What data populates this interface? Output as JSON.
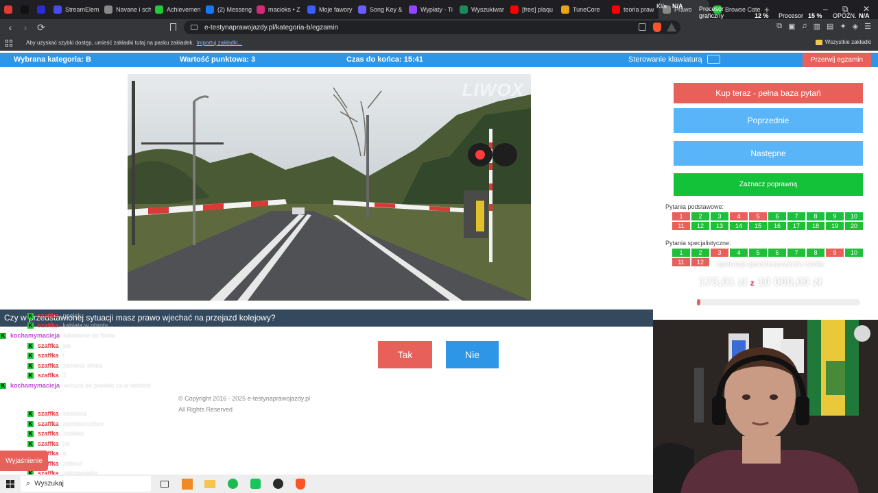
{
  "browser": {
    "tabs": [
      {
        "label": "",
        "color": "#e53935"
      },
      {
        "label": "",
        "color": "#111111"
      },
      {
        "label": "",
        "color": "#2b2bd6"
      },
      {
        "label": "StreamElem",
        "color": "#4a4af0"
      },
      {
        "label": "Navane i sch",
        "color": "#888888"
      },
      {
        "label": "Achievemen",
        "color": "#22c73a"
      },
      {
        "label": "(2) Messeng",
        "color": "#1877f2"
      },
      {
        "label": "macioks • Z",
        "color": "#d62976"
      },
      {
        "label": "Moje fawory",
        "color": "#3b5cff"
      },
      {
        "label": "Song Key &",
        "color": "#6b5cff"
      },
      {
        "label": "Wypłaty - Ti",
        "color": "#9146ff"
      },
      {
        "label": "Wyszukiwar",
        "color": "#1a8a5a"
      },
      {
        "label": "[free] plaqu",
        "color": "#ff0000"
      },
      {
        "label": "TuneCore",
        "color": "#e8a317"
      },
      {
        "label": "teoria praw",
        "color": "#ff0000"
      },
      {
        "label": "Prawo",
        "color": "#888888"
      },
      {
        "label": "Browse Cate",
        "color": "#22c73a"
      }
    ],
    "new_tab": "+",
    "stats": {
      "net_label": "Kl/s",
      "net_value": "N/A",
      "gpu_label": "Procesor graficzny",
      "gpu_value": "12 %",
      "cpu_label": "Procesor",
      "cpu_value": "15 %",
      "lag_label": "OPÓŹN.",
      "lag_value": "N/A"
    },
    "window_controls": {
      "minimize": "–",
      "restore": "⧉",
      "close": "✕"
    },
    "nav": {
      "back": "‹",
      "forward": "›",
      "reload": "⟳"
    },
    "url": "e-testynaprawojazdy.pl/kategoria-b/egzamin",
    "bookmarks_hint": "Aby uzyskać szybki dostęp, umieść zakładki tutaj na pasku zakładek.",
    "bookmarks_import": "Importuj zakładki...",
    "bookmarks_all": "Wszystkie zakładki"
  },
  "exam": {
    "category": "Wybrana kategoria: B",
    "points": "Wartość punktowa: 3",
    "time": "Czas do końca: 15:41",
    "keyboard": "Sterowanie klawiaturą",
    "break_button": "Przerwij egzamin",
    "watermark": "LIWOX",
    "buy_button": "Kup teraz - pełna baza pytań",
    "prev_button": "Poprzednie",
    "next_button": "Następne",
    "mark_button": "Zaznacz poprawną",
    "basic_label": "Pytania podstawowe:",
    "basic_questions": [
      {
        "n": "1",
        "s": "r"
      },
      {
        "n": "2",
        "s": "g"
      },
      {
        "n": "3",
        "s": "g"
      },
      {
        "n": "4",
        "s": "r"
      },
      {
        "n": "5",
        "s": "r"
      },
      {
        "n": "6",
        "s": "g"
      },
      {
        "n": "7",
        "s": "g"
      },
      {
        "n": "8",
        "s": "g"
      },
      {
        "n": "9",
        "s": "g"
      },
      {
        "n": "10",
        "s": "g"
      },
      {
        "n": "11",
        "s": "r"
      },
      {
        "n": "12",
        "s": "g"
      },
      {
        "n": "13",
        "s": "g"
      },
      {
        "n": "14",
        "s": "g"
      },
      {
        "n": "15",
        "s": "g"
      },
      {
        "n": "16",
        "s": "g"
      },
      {
        "n": "17",
        "s": "g"
      },
      {
        "n": "18",
        "s": "g"
      },
      {
        "n": "19",
        "s": "g"
      },
      {
        "n": "20",
        "s": "g"
      }
    ],
    "special_label": "Pytania specjalistyczne:",
    "special_questions": [
      {
        "n": "1",
        "s": "g"
      },
      {
        "n": "2",
        "s": "g"
      },
      {
        "n": "3",
        "s": "r"
      },
      {
        "n": "4",
        "s": "g"
      },
      {
        "n": "5",
        "s": "g"
      },
      {
        "n": "6",
        "s": "g"
      },
      {
        "n": "7",
        "s": "g"
      },
      {
        "n": "8",
        "s": "g"
      },
      {
        "n": "9",
        "s": "r"
      },
      {
        "n": "10",
        "s": "g"
      },
      {
        "n": "11",
        "s": "r"
      },
      {
        "n": "12",
        "s": "r"
      }
    ],
    "question": "Czy w przedstawionej sytuacji masz prawo wjechać na przejazd kolejowy?",
    "yes": "Tak",
    "no": "Nie",
    "copyright": "© Copyright 2016 - 2025 e-testynaprawojazdy.pl",
    "rights": "All Rights Reserved",
    "explain_button": "Wyjaśnienie"
  },
  "overlay": {
    "goal_title": "operacja pomieszczenia czoła",
    "amount": "173,01 zł",
    "separator": "z",
    "goal": "10 000,00 zł",
    "progress": 0.017
  },
  "chat": [
    {
      "name": "szaffka",
      "text": "peelek",
      "color": "#e0373f"
    },
    {
      "name": "szaffka",
      "text": "kablata w obroty",
      "color": "#e0373f"
    },
    {
      "name": "kochamymaciejа",
      "text": "taktownie do fbrew",
      "color": "#c24fd6"
    },
    {
      "name": "szaffka",
      "text": "tak",
      "color": "#e0373f"
    },
    {
      "name": "szaffka",
      "text": "t",
      "color": "#e0373f"
    },
    {
      "name": "szaffka",
      "text": "zamiesz efeka",
      "color": "#e0373f"
    },
    {
      "name": "szaffka",
      "text": "2",
      "color": "#e0373f"
    },
    {
      "name": "kochamymaciejа",
      "text": "wrzuca do prawda za w wtedzie",
      "color": "#c24fd6"
    },
    {
      "name": "szaffka",
      "text": "zaoblasz",
      "color": "#e0373f"
    },
    {
      "name": "szaffka",
      "text": "zaoblaszcabze",
      "color": "#e0373f"
    },
    {
      "name": "szaffka",
      "text": "zaoblaz",
      "color": "#e0373f"
    },
    {
      "name": "szaffka",
      "text": "ne",
      "color": "#e0373f"
    },
    {
      "name": "szaffka",
      "text": "a",
      "color": "#e0373f"
    },
    {
      "name": "szaffka",
      "text": "zabesz",
      "color": "#e0373f"
    },
    {
      "name": "szaffka",
      "text": "zakpowiadsz",
      "color": "#e0373f"
    }
  ],
  "taskbar": {
    "search": "Wyszukaj"
  },
  "colors": {
    "header_blue": "#2d96e6",
    "red": "#e8605a",
    "light_blue": "#5ab4f8",
    "green": "#14c23a",
    "question_bar": "#34495e"
  }
}
